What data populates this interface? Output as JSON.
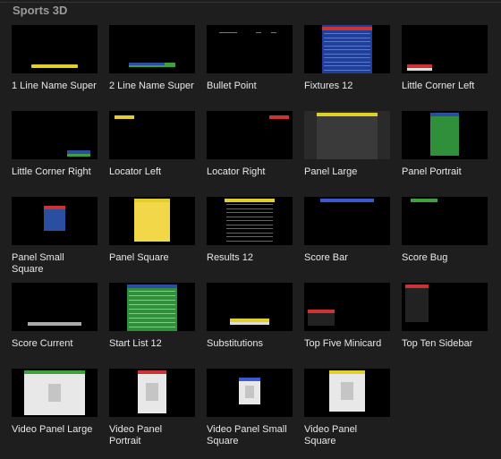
{
  "section": {
    "title": "Sports 3D"
  },
  "items": [
    {
      "label": "1 Line Name Super",
      "thumb": "lower-third-yellow"
    },
    {
      "label": "2 Line Name Super",
      "thumb": "lower-third-green"
    },
    {
      "label": "Bullet Point",
      "thumb": "bullets"
    },
    {
      "label": "Fixtures 12",
      "thumb": "fixtures"
    },
    {
      "label": "Little Corner Left",
      "thumb": "corner-left"
    },
    {
      "label": "Little Corner Right",
      "thumb": "corner-right"
    },
    {
      "label": "Locator Left",
      "thumb": "locator-left"
    },
    {
      "label": "Locator Right",
      "thumb": "locator-right"
    },
    {
      "label": "Panel Large",
      "thumb": "panel-large"
    },
    {
      "label": "Panel Portrait",
      "thumb": "panel-portrait"
    },
    {
      "label": "Panel Small Square",
      "thumb": "panel-small"
    },
    {
      "label": "Panel Square",
      "thumb": "panel-square"
    },
    {
      "label": "Results 12",
      "thumb": "results"
    },
    {
      "label": "Score Bar",
      "thumb": "score-bar"
    },
    {
      "label": "Score Bug",
      "thumb": "score-bug"
    },
    {
      "label": "Score Current",
      "thumb": "score-current"
    },
    {
      "label": "Start List 12",
      "thumb": "start-list"
    },
    {
      "label": "Substitutions",
      "thumb": "subs"
    },
    {
      "label": "Top Five Minicard",
      "thumb": "top-five"
    },
    {
      "label": "Top Ten Sidebar",
      "thumb": "top-ten"
    },
    {
      "label": "Video Panel Large",
      "thumb": "video-large"
    },
    {
      "label": "Video Panel Portrait",
      "thumb": "video-portrait"
    },
    {
      "label": "Video Panel Small Square",
      "thumb": "video-small"
    },
    {
      "label": "Video Panel Square",
      "thumb": "video-square"
    }
  ]
}
